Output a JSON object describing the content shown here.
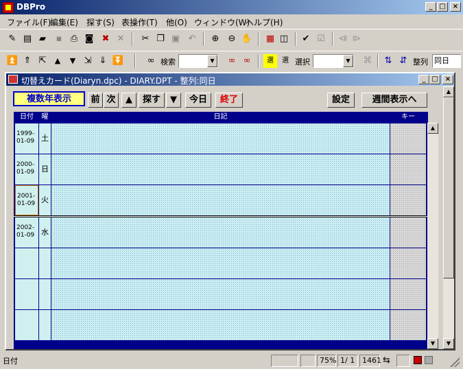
{
  "app": {
    "title": "DBPro"
  },
  "menu": [
    "ファイル(F)",
    "編集(E)",
    "探す(S)",
    "表操作(T)",
    "他(O)",
    "ウィンドウ(W)",
    "ヘルプ(H)"
  ],
  "toolbar2": {
    "search_label": "検索",
    "select_label": "選択",
    "sort_label": "整列",
    "sort_value": "同日"
  },
  "child": {
    "title": "切替えカード(Diaryn.dpc) - DIARY.DPT - 整列:同日",
    "buttons": {
      "multi_year": "複数年表示",
      "prev": "前",
      "next": "次",
      "search": "探す",
      "today": "今日",
      "end": "終了",
      "settings": "設定",
      "weekly": "週間表示へ"
    },
    "columns": {
      "date": "日付",
      "weekday": "曜",
      "diary": "日記",
      "key": "キー"
    },
    "rows": [
      {
        "date1": "1999-",
        "date2": "01-09",
        "day": "土"
      },
      {
        "date1": "2000-",
        "date2": "01-09",
        "day": "日"
      },
      {
        "date1": "2001-",
        "date2": "01-09",
        "day": "火"
      },
      {
        "date1": "2002-",
        "date2": "01-09",
        "day": "水"
      },
      {
        "date1": "",
        "date2": "",
        "day": ""
      },
      {
        "date1": "",
        "date2": "",
        "day": ""
      },
      {
        "date1": "",
        "date2": "",
        "day": ""
      }
    ]
  },
  "status": {
    "field": "日付",
    "zoom": "75%",
    "page": "1/ 1",
    "count": "1461"
  },
  "colors": {
    "titlebar": "#0a246a",
    "grid_border": "#00008b",
    "cell_bg": "#c8f0f0",
    "end_button": "#e00000",
    "multi_year_bg": "#ffff80"
  }
}
